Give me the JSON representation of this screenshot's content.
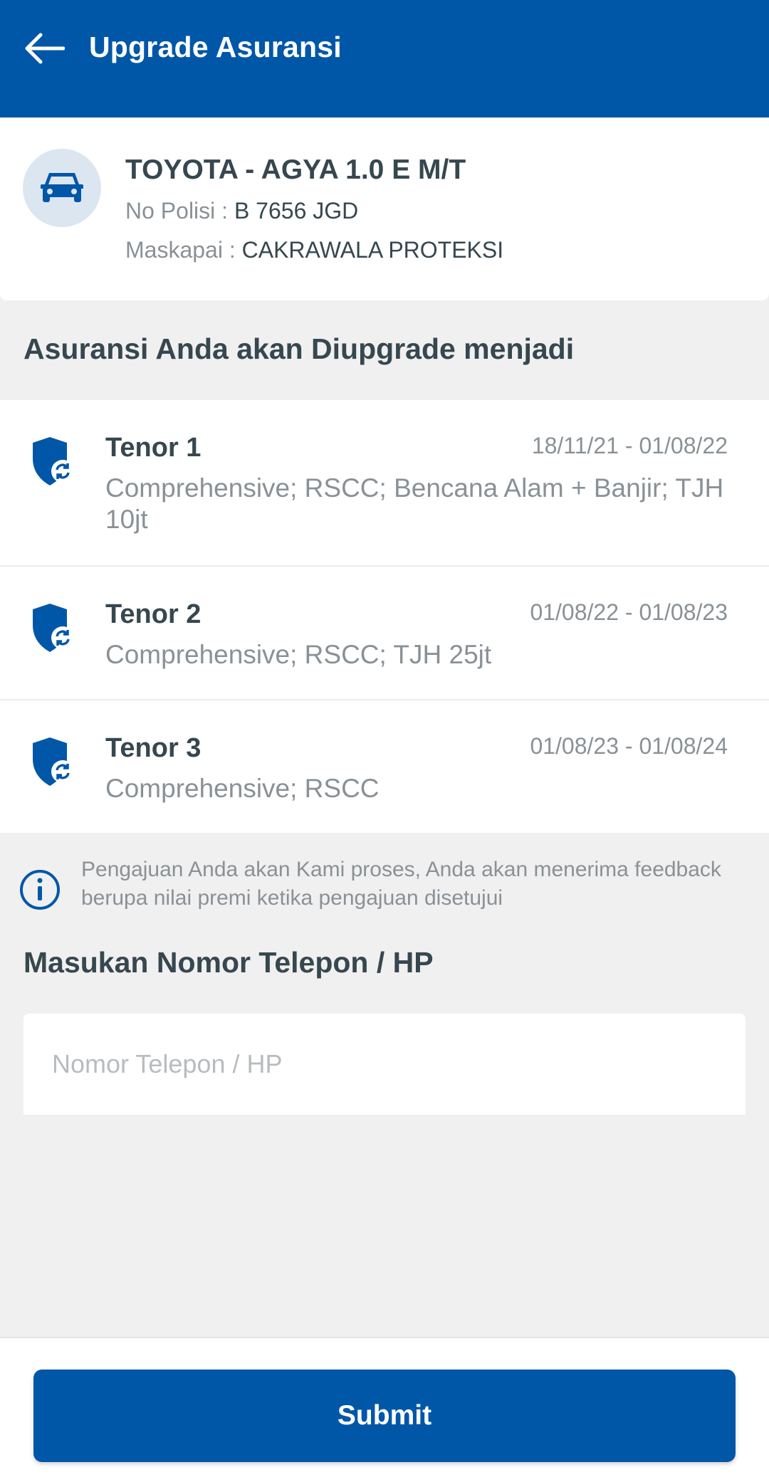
{
  "appbar": {
    "title": "Upgrade Asuransi",
    "background": "#0057a8",
    "back_icon": "arrow-left-icon"
  },
  "vehicle": {
    "icon": "car-icon",
    "name": "TOYOTA - AGYA 1.0 E M/T",
    "polisi_label": "No Polisi : ",
    "polisi_value": "B 7656 JGD",
    "maskapai_label": "Maskapai : ",
    "maskapai_value": "CAKRAWALA PROTEKSI"
  },
  "upgrade_section": {
    "title": "Asuransi Anda akan Diupgrade menjadi"
  },
  "tenors": [
    {
      "name": "Tenor 1",
      "period": "18/11/21 - 01/08/22",
      "coverage": "Comprehensive; RSCC; Bencana Alam + Banjir; TJH 10jt",
      "icon": "shield-refresh-icon"
    },
    {
      "name": "Tenor 2",
      "period": "01/08/22 - 01/08/23",
      "coverage": "Comprehensive; RSCC; TJH 25jt",
      "icon": "shield-refresh-icon"
    },
    {
      "name": "Tenor 3",
      "period": "01/08/23 - 01/08/24",
      "coverage": "Comprehensive; RSCC",
      "icon": "shield-refresh-icon"
    }
  ],
  "info": {
    "icon": "info-icon",
    "text": "Pengajuan Anda akan Kami proses, Anda akan menerima feedback berupa nilai premi ketika pengajuan disetujui"
  },
  "phone": {
    "title": "Masukan Nomor Telepon / HP",
    "placeholder": "Nomor Telepon / HP",
    "value": ""
  },
  "submit": {
    "label": "Submit"
  },
  "colors": {
    "primary": "#0057a8",
    "text_dark": "#37474f",
    "text_muted": "#8a9196",
    "background": "#f0f0f0",
    "avatar_bg": "#dce6f1"
  }
}
